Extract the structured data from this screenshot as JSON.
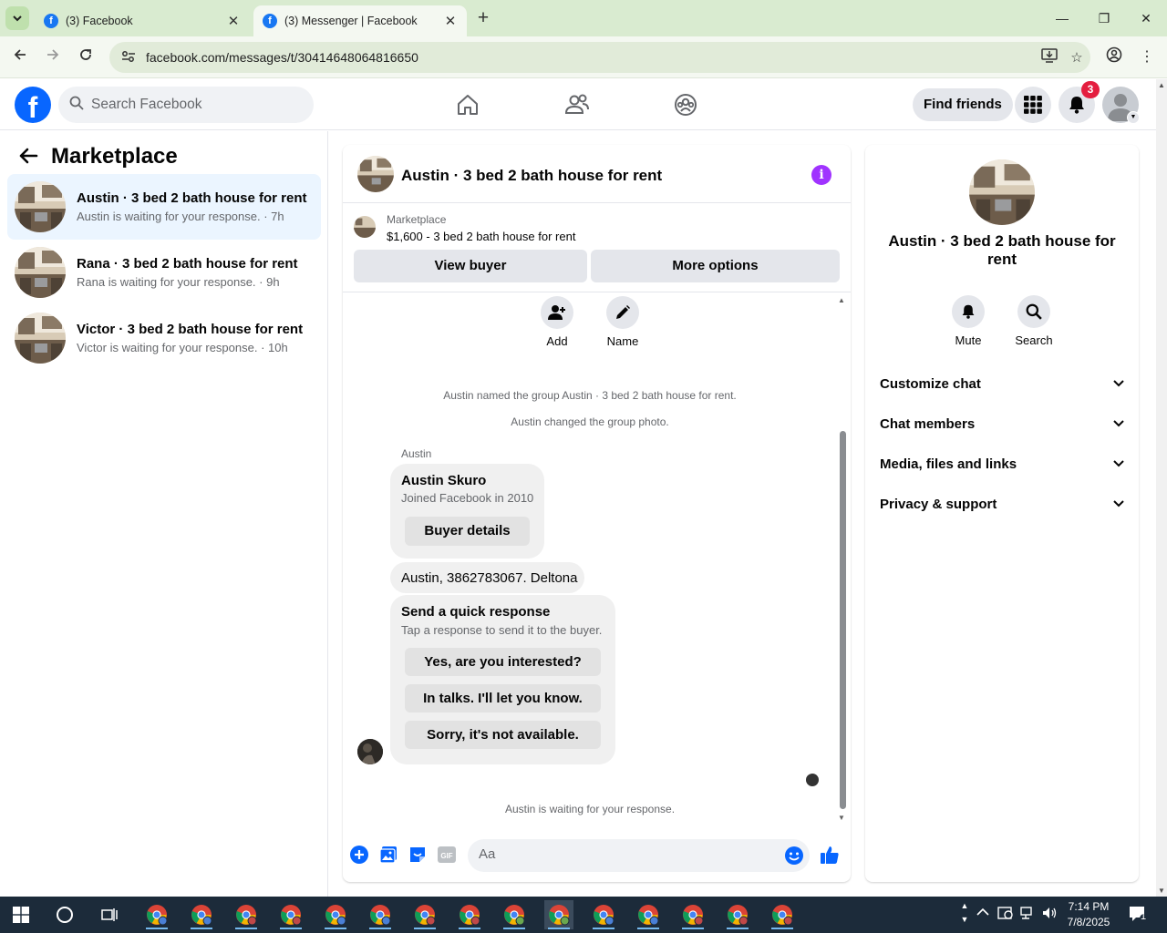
{
  "browser": {
    "tabs": [
      {
        "label": "(3) Facebook",
        "active": false
      },
      {
        "label": "(3) Messenger | Facebook",
        "active": true
      }
    ],
    "url": "facebook.com/messages/t/30414648064816650"
  },
  "fb_header": {
    "search_placeholder": "Search Facebook",
    "find_friends": "Find friends",
    "notification_count": "3",
    "icons": [
      "home-icon",
      "friends-icon",
      "groups-icon",
      "menu-grid-icon",
      "bell-icon"
    ],
    "brand_color": "#0866ff"
  },
  "sidebar": {
    "title": "Marketplace",
    "conversations": [
      {
        "title": "Austin · 3 bed 2 bath house for rent",
        "subtitle": "Austin is waiting for your response. · 7h",
        "active": true
      },
      {
        "title": "Rana · 3 bed 2 bath house for rent",
        "subtitle": "Rana is waiting for your response. · 9h",
        "active": false
      },
      {
        "title": "Victor · 3 bed 2 bath house for rent",
        "subtitle": "Victor is waiting for your response. · 10h",
        "active": false
      }
    ]
  },
  "chat": {
    "title": "Austin · 3 bed 2 bath house for rent",
    "listing": {
      "label": "Marketplace",
      "price_title": "$1,600 - 3 bed 2 bath house for rent"
    },
    "view_buyer": "View buyer",
    "more_options": "More options",
    "actions": {
      "add": "Add",
      "name": "Name"
    },
    "system_messages": [
      "Austin named the group Austin · 3 bed 2 bath house for rent.",
      "Austin changed the group photo."
    ],
    "sender": "Austin",
    "profile_card": {
      "name": "Austin Skuro",
      "joined": "Joined Facebook in 2010",
      "button": "Buyer details"
    },
    "message": "Austin, 3862783067. Deltona",
    "quick_response": {
      "title": "Send a quick response",
      "subtitle": "Tap a response to send it to the buyer.",
      "options": [
        "Yes, are you interested?",
        "In talks. I'll let you know.",
        "Sorry, it's not available."
      ]
    },
    "waiting": "Austin is waiting for your response.",
    "composer_placeholder": "Aa",
    "accent_color": "#0866ff"
  },
  "info_panel": {
    "title": "Austin · 3 bed 2 bath house for rent",
    "actions": {
      "mute": "Mute",
      "search": "Search"
    },
    "sections": [
      "Customize chat",
      "Chat members",
      "Media, files and links",
      "Privacy & support"
    ]
  },
  "taskbar": {
    "time": "7:14 PM",
    "date": "7/8/2025",
    "notification_count": "1"
  }
}
